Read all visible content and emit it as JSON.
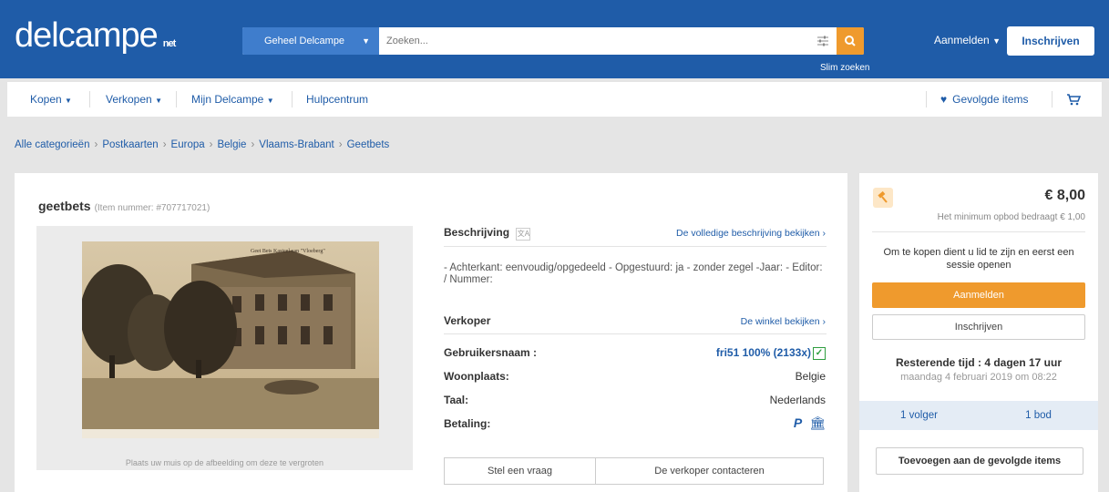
{
  "header": {
    "logo": "delcampe",
    "logo_suffix": "net",
    "search_scope": "Geheel Delcampe",
    "search_placeholder": "Zoeken...",
    "smart_search": "Slim zoeken",
    "login": "Aanmelden",
    "signup": "Inschrijven"
  },
  "nav": {
    "buy": "Kopen",
    "sell": "Verkopen",
    "my_delcampe": "Mijn Delcampe",
    "help": "Hulpcentrum",
    "followed": "Gevolgde items"
  },
  "breadcrumb": [
    "Alle categorieën",
    "Postkaarten",
    "Europa",
    "Belgie",
    "Vlaams-Brabant",
    "Geetbets"
  ],
  "item": {
    "title": "geetbets",
    "item_number": "(Item nummer: #707717021)",
    "image_caption": "Plaats uw muis op de afbeelding om deze te vergroten",
    "postcard_text": "Geet Bets   Kasteel van \"Vloeberg\""
  },
  "description": {
    "heading": "Beschrijving",
    "full_link": "De volledige beschrijving bekijken ›",
    "text": "- Achterkant: eenvoudig/opgedeeld - Opgestuurd: ja - zonder zegel -Jaar: - Editor: / Nummer:"
  },
  "seller": {
    "heading": "Verkoper",
    "shop_link": "De winkel bekijken ›",
    "username_label": "Gebruikersnaam :",
    "username_value": "fri51 100% (2133x)",
    "residence_label": "Woonplaats:",
    "residence_value": "Belgie",
    "language_label": "Taal:",
    "language_value": "Nederlands",
    "payment_label": "Betaling:"
  },
  "actions": {
    "ask": "Stel een vraag",
    "contact": "De verkoper contacteren"
  },
  "sidebar": {
    "price": "€ 8,00",
    "min_bid": "Het minimum opbod bedraagt € 1,00",
    "message": "Om te kopen dient u lid te zijn en eerst een sessie openen",
    "login": "Aanmelden",
    "signup": "Inschrijven",
    "remaining": "Resterende tijd : 4 dagen 17 uur",
    "end_date": "maandag 4 februari 2019 om 08:22",
    "followers": "1 volger",
    "bids": "1 bod",
    "add_followed": "Toevoegen aan de gevolgde items"
  },
  "colors": {
    "brand_blue": "#1f5ca8",
    "accent_orange": "#ef9a2d"
  }
}
